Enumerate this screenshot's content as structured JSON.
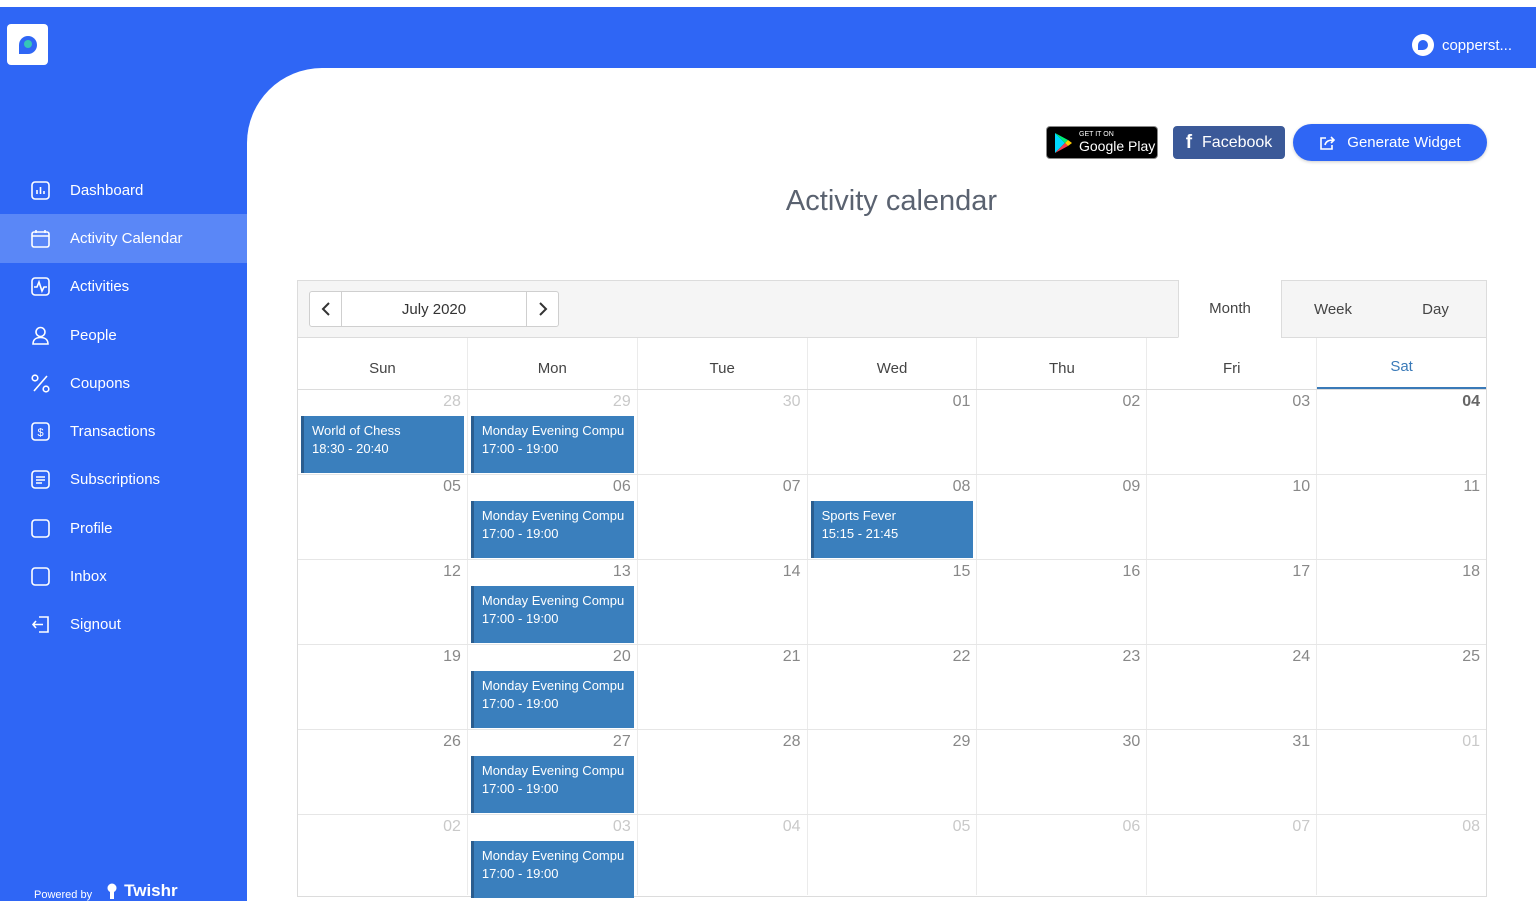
{
  "user": {
    "name": "copperst..."
  },
  "sidebar": {
    "items": [
      {
        "label": "Dashboard",
        "icon": "dashboard-icon"
      },
      {
        "label": "Activity Calendar",
        "icon": "calendar-icon",
        "active": true
      },
      {
        "label": "Activities",
        "icon": "activity-icon"
      },
      {
        "label": "People",
        "icon": "person-icon"
      },
      {
        "label": "Coupons",
        "icon": "percent-icon"
      },
      {
        "label": "Transactions",
        "icon": "dollar-icon"
      },
      {
        "label": "Subscriptions",
        "icon": "list-icon"
      },
      {
        "label": "Profile",
        "icon": "square-icon"
      },
      {
        "label": "Inbox",
        "icon": "square-icon"
      },
      {
        "label": "Signout",
        "icon": "signout-icon"
      }
    ],
    "powered_by": "Powered by",
    "brand": "Twishr"
  },
  "header_buttons": {
    "google_play_small": "GET IT ON",
    "google_play_big": "Google Play",
    "facebook": "Facebook",
    "generate_widget": "Generate Widget"
  },
  "page": {
    "title": "Activity calendar"
  },
  "calendar": {
    "month_label": "July 2020",
    "views": [
      "Month",
      "Week",
      "Day"
    ],
    "active_view": "Month",
    "weekdays": [
      "Sun",
      "Mon",
      "Tue",
      "Wed",
      "Thu",
      "Fri",
      "Sat"
    ],
    "today_weekday_index": 6,
    "weeks": [
      [
        {
          "d": "28",
          "other": true,
          "event": {
            "title": "World of Chess",
            "time": "18:30 - 20:40"
          }
        },
        {
          "d": "29",
          "other": true,
          "event": {
            "title": "Monday Evening Compu",
            "time": "17:00 - 19:00"
          }
        },
        {
          "d": "30",
          "other": true
        },
        {
          "d": "01"
        },
        {
          "d": "02"
        },
        {
          "d": "03"
        },
        {
          "d": "04",
          "today": true
        }
      ],
      [
        {
          "d": "05"
        },
        {
          "d": "06",
          "event": {
            "title": "Monday Evening Compu",
            "time": "17:00 - 19:00"
          }
        },
        {
          "d": "07"
        },
        {
          "d": "08",
          "event": {
            "title": "Sports Fever",
            "time": "15:15 - 21:45"
          }
        },
        {
          "d": "09"
        },
        {
          "d": "10"
        },
        {
          "d": "11"
        }
      ],
      [
        {
          "d": "12"
        },
        {
          "d": "13",
          "event": {
            "title": "Monday Evening Compu",
            "time": "17:00 - 19:00"
          }
        },
        {
          "d": "14"
        },
        {
          "d": "15"
        },
        {
          "d": "16"
        },
        {
          "d": "17"
        },
        {
          "d": "18"
        }
      ],
      [
        {
          "d": "19"
        },
        {
          "d": "20",
          "event": {
            "title": "Monday Evening Compu",
            "time": "17:00 - 19:00"
          }
        },
        {
          "d": "21"
        },
        {
          "d": "22"
        },
        {
          "d": "23"
        },
        {
          "d": "24"
        },
        {
          "d": "25"
        }
      ],
      [
        {
          "d": "26"
        },
        {
          "d": "27",
          "event": {
            "title": "Monday Evening Compu",
            "time": "17:00 - 19:00"
          }
        },
        {
          "d": "28"
        },
        {
          "d": "29"
        },
        {
          "d": "30"
        },
        {
          "d": "31"
        },
        {
          "d": "01",
          "other": true
        }
      ],
      [
        {
          "d": "02",
          "other": true
        },
        {
          "d": "03",
          "other": true,
          "event": {
            "title": "Monday Evening Compu",
            "time": "17:00 - 19:00"
          }
        },
        {
          "d": "04",
          "other": true
        },
        {
          "d": "05",
          "other": true
        },
        {
          "d": "06",
          "other": true
        },
        {
          "d": "07",
          "other": true
        },
        {
          "d": "08",
          "other": true
        }
      ]
    ]
  }
}
